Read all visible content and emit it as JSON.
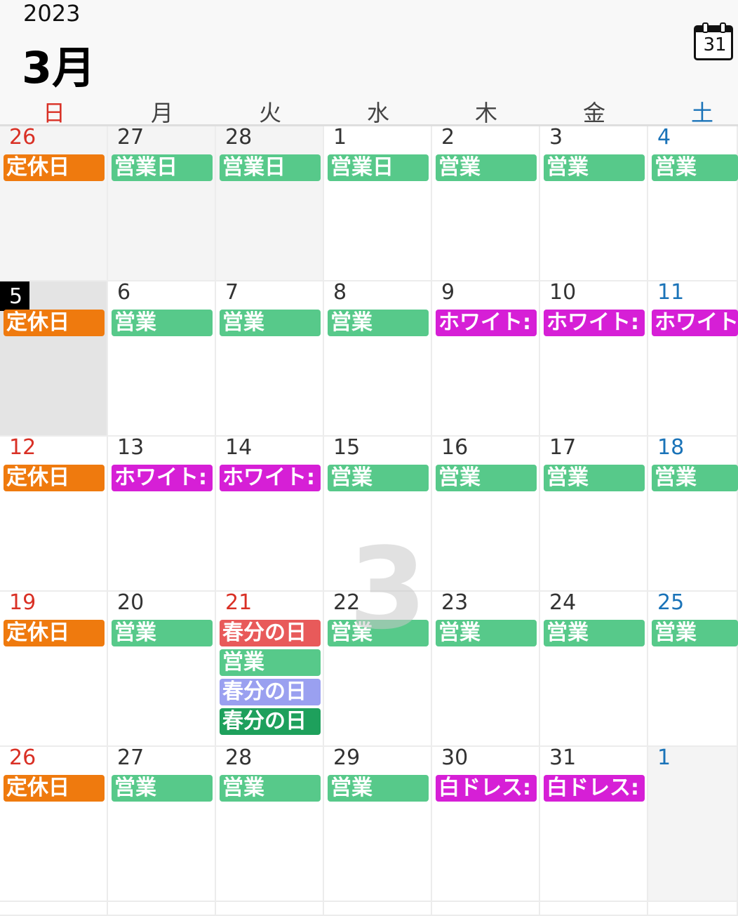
{
  "header": {
    "year": "2023",
    "month": "3月",
    "today_icon_label": "31"
  },
  "weekdays": [
    "日",
    "月",
    "火",
    "水",
    "木",
    "金",
    "土"
  ],
  "colors": {
    "sunday": "#d93025",
    "saturday": "#1a73b8",
    "orange": "#ef7a0e",
    "green": "#57c98a",
    "magenta": "#d61fd6",
    "red": "#e85a5a",
    "lavender": "#9aa0f0",
    "darkgreen": "#1ea05c"
  },
  "watermark": "3",
  "weeks": [
    [
      {
        "date": "26",
        "other": true,
        "events": [
          {
            "title": "定休日",
            "color": "orange"
          }
        ]
      },
      {
        "date": "27",
        "other": true,
        "events": [
          {
            "title": "営業日",
            "color": "green"
          }
        ]
      },
      {
        "date": "28",
        "other": true,
        "events": [
          {
            "title": "営業日",
            "color": "green"
          }
        ]
      },
      {
        "date": "1",
        "events": [
          {
            "title": "営業日",
            "color": "green"
          }
        ]
      },
      {
        "date": "2",
        "events": [
          {
            "title": "営業",
            "color": "green"
          }
        ]
      },
      {
        "date": "3",
        "events": [
          {
            "title": "営業",
            "color": "green"
          }
        ]
      },
      {
        "date": "4",
        "events": [
          {
            "title": "営業",
            "color": "green"
          }
        ]
      }
    ],
    [
      {
        "date": "5",
        "today": true,
        "events": [
          {
            "title": "定休日",
            "color": "orange"
          }
        ]
      },
      {
        "date": "6",
        "events": [
          {
            "title": "営業",
            "color": "green"
          }
        ]
      },
      {
        "date": "7",
        "events": [
          {
            "title": "営業",
            "color": "green"
          }
        ]
      },
      {
        "date": "8",
        "events": [
          {
            "title": "営業",
            "color": "green"
          }
        ]
      },
      {
        "date": "9",
        "events": [
          {
            "title": "ホワイト:",
            "color": "magenta"
          }
        ]
      },
      {
        "date": "10",
        "events": [
          {
            "title": "ホワイト:",
            "color": "magenta"
          }
        ]
      },
      {
        "date": "11",
        "events": [
          {
            "title": "ホワイト",
            "color": "magenta"
          }
        ]
      }
    ],
    [
      {
        "date": "12",
        "events": [
          {
            "title": "定休日",
            "color": "orange"
          }
        ]
      },
      {
        "date": "13",
        "events": [
          {
            "title": "ホワイト:",
            "color": "magenta"
          }
        ]
      },
      {
        "date": "14",
        "events": [
          {
            "title": "ホワイト:",
            "color": "magenta"
          }
        ]
      },
      {
        "date": "15",
        "events": [
          {
            "title": "営業",
            "color": "green"
          }
        ]
      },
      {
        "date": "16",
        "events": [
          {
            "title": "営業",
            "color": "green"
          }
        ]
      },
      {
        "date": "17",
        "events": [
          {
            "title": "営業",
            "color": "green"
          }
        ]
      },
      {
        "date": "18",
        "events": [
          {
            "title": "営業",
            "color": "green"
          }
        ]
      }
    ],
    [
      {
        "date": "19",
        "events": [
          {
            "title": "定休日",
            "color": "orange"
          }
        ]
      },
      {
        "date": "20",
        "events": [
          {
            "title": "営業",
            "color": "green"
          }
        ]
      },
      {
        "date": "21",
        "holiday": true,
        "events": [
          {
            "title": "春分の日",
            "color": "red"
          },
          {
            "title": "営業",
            "color": "green"
          },
          {
            "title": "春分の日",
            "color": "lavender"
          },
          {
            "title": "春分の日",
            "color": "darkgreen"
          }
        ]
      },
      {
        "date": "22",
        "events": [
          {
            "title": "営業",
            "color": "green"
          }
        ]
      },
      {
        "date": "23",
        "events": [
          {
            "title": "営業",
            "color": "green"
          }
        ]
      },
      {
        "date": "24",
        "events": [
          {
            "title": "営業",
            "color": "green"
          }
        ]
      },
      {
        "date": "25",
        "events": [
          {
            "title": "営業",
            "color": "green"
          }
        ]
      }
    ],
    [
      {
        "date": "26",
        "events": [
          {
            "title": "定休日",
            "color": "orange"
          }
        ]
      },
      {
        "date": "27",
        "events": [
          {
            "title": "営業",
            "color": "green"
          }
        ]
      },
      {
        "date": "28",
        "events": [
          {
            "title": "営業",
            "color": "green"
          }
        ]
      },
      {
        "date": "29",
        "events": [
          {
            "title": "営業",
            "color": "green"
          }
        ]
      },
      {
        "date": "30",
        "events": [
          {
            "title": "白ドレス:",
            "color": "magenta"
          }
        ]
      },
      {
        "date": "31",
        "events": [
          {
            "title": "白ドレス:",
            "color": "magenta"
          }
        ]
      },
      {
        "date": "1",
        "other": true,
        "events": []
      }
    ]
  ]
}
